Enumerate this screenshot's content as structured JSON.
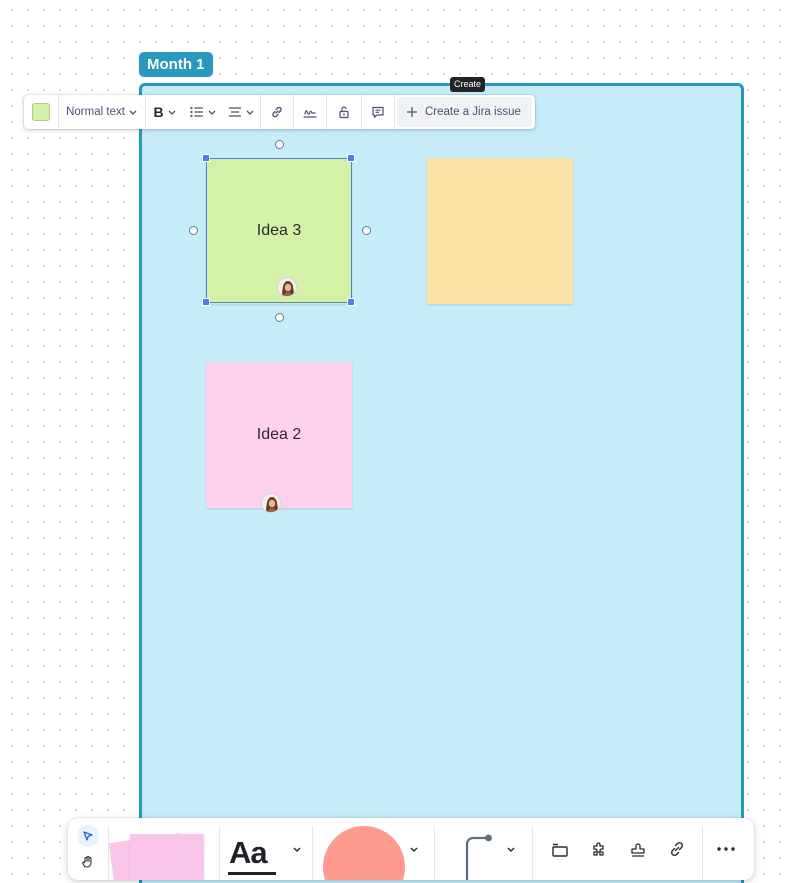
{
  "frame": {
    "label": "Month 1",
    "color": "#2898bd",
    "fill": "#c6ecfa"
  },
  "tooltip": {
    "text": "Create"
  },
  "toolbar": {
    "color_swatch": "#d3f1a7",
    "text_style": "Normal text",
    "bold_label": "B",
    "jira_label": "Create a Jira issue"
  },
  "notes": [
    {
      "text": "Idea 3",
      "color": "#d3f1a7"
    },
    {
      "text": "",
      "color": "#fce4a8"
    },
    {
      "text": "Idea 2",
      "color": "#fdd0ec"
    }
  ],
  "bottom_toolbar": {
    "text_tool_label": "Aa",
    "shape_color": "#ff9a8e",
    "sticky_color": "#f9c6ea",
    "icons": [
      "select-arrow-icon",
      "hand-icon",
      "chevron-down-icon",
      "connector-icon",
      "frame-icon",
      "puzzle-icon",
      "stamp-icon",
      "link-icon",
      "more-icon"
    ]
  }
}
